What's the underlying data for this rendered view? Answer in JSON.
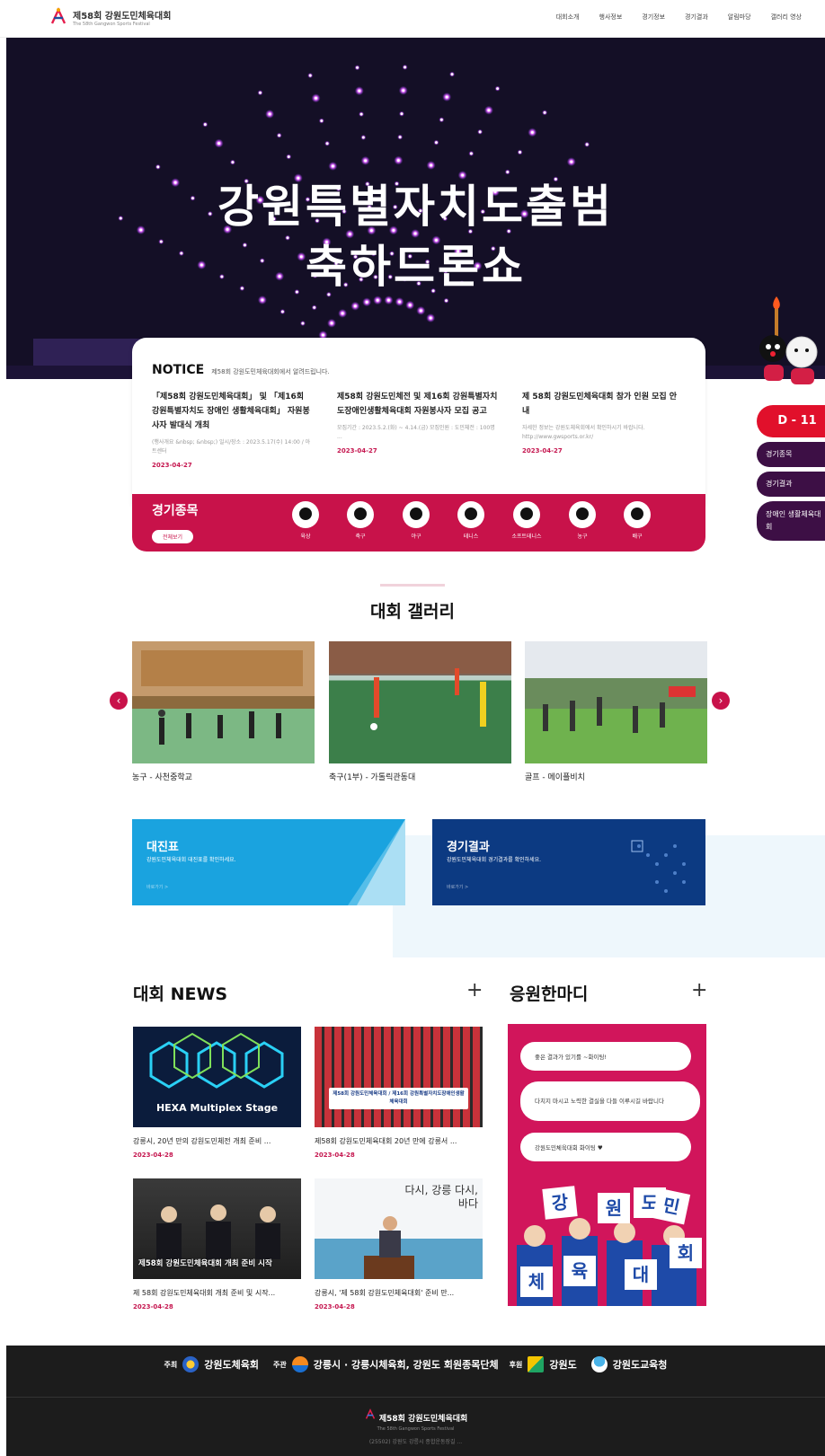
{
  "header": {
    "logo_title": "제58회 강원도민체육대회",
    "logo_sub": "The 58th Gangwon Sports Festival",
    "nav": [
      "대회소개",
      "행사정보",
      "경기정보",
      "경기결과",
      "알림마당",
      "갤러리 영상"
    ]
  },
  "hero": {
    "line1": "강원특별자치도출범",
    "line2": "축하드론쇼"
  },
  "notice": {
    "title": "NOTICE",
    "subtitle": "제58회 강원도민체육대회에서 알려드립니다.",
    "items": [
      {
        "title": "「제58회 강원도민체육대회」 및 「제16회 강원특별자치도 장애인 생활체육대회」 자원봉사자 발대식 개최",
        "summary": "(행사개요 &nbsp; &nbsp;) 일시/장소 : 2023.5.17(수) 14:00 / 아트센터",
        "date": "2023-04-27"
      },
      {
        "title": "제58회 강원도민체전 및 제16회 강원특별자치도장애인생활체육대회 자원봉사자 모집 공고",
        "summary": "모집기간 : 2023.5.2.(화) ~ 4.14.(금) 모집인원 : 도민체전 : 100명 ...",
        "date": "2023-04-27"
      },
      {
        "title": "제 58회 강원도민체육대회 참가 인원 모집 안내",
        "summary": "자세한 정보는 강원도체육회에서 확인하시기 바랍니다. http://www.gwsports.or.kr/",
        "date": "2023-04-27"
      }
    ]
  },
  "sports": {
    "title": "경기종목",
    "all_label": "전체보기",
    "items": [
      "육상",
      "축구",
      "야구",
      "테니스",
      "소프트테니스",
      "농구",
      "배구"
    ]
  },
  "side": {
    "dday": "D - 11",
    "items": [
      "경기종목",
      "경기결과",
      "장애인 생활체육대회"
    ]
  },
  "gallery": {
    "title": "대회 갤러리",
    "items": [
      {
        "label": "농구 - 사천중학교"
      },
      {
        "label": "축구(1부) - 가톨릭관동대"
      },
      {
        "label": "골프 - 메이플비치"
      }
    ]
  },
  "banners": [
    {
      "title": "대진표",
      "sub": "강원도민체육대회 대진표를 확인하세요.",
      "more": "바로가기 >",
      "color": "#1aa3df"
    },
    {
      "title": "경기결과",
      "sub": "강원도민체육대회 경기결과를 확인하세요.",
      "more": "바로가기 >",
      "color": "#0c3a82"
    }
  ],
  "news": {
    "title": "대회 NEWS",
    "items": [
      {
        "title": "강릉시, 20년 만의 강원도민체전 개최 준비 ...",
        "date": "2023-04-28",
        "img_text": "HEXA Multiplex Stage"
      },
      {
        "title": "제58회 강원도민체육대회 20년 만에 강릉서 ...",
        "date": "2023-04-28",
        "img_text": "제58회 강원도민체육대회 / 제16회 강원특별자치도장애인생활체육대회"
      },
      {
        "title": "제 58회 강원도민체육대회 개최 준비 및 시작...",
        "date": "2023-04-28",
        "img_text": "제58회 강원도민체육대회 개최 준비 시작"
      },
      {
        "title": "강릉시, '제 58회 강원도민체육대회' 준비 만...",
        "date": "2023-04-28",
        "img_text": "다시, 강릉 다시, 바다"
      }
    ]
  },
  "cheer": {
    "title": "응원한마디",
    "messages": [
      "좋은 결과가 있기를 ~화이팅!",
      "다치지 마시고 노력한 결실을 다들 이루시길 바랍니다",
      "강원도민체육대회 화이팅 ♥"
    ],
    "letters": [
      "강",
      "원",
      "도",
      "민",
      "체",
      "육",
      "대",
      "회"
    ]
  },
  "footer": {
    "host_label": "주최",
    "host": "강원도체육회",
    "org_label": "주관",
    "org": "강릉시 · 강릉시체육회, 강원도 회원종목단체",
    "sponsor_label": "후원",
    "sponsor1": "강원도",
    "sponsor2": "강원도교육청",
    "logo": "제58회 강원도민체육대회",
    "logo_sub": "The 58th Gangwon Sports Festival",
    "address": "(25502) 강원도 강릉시 종합운동장길 ..."
  },
  "colors": {
    "accent": "#c8124a",
    "hero_bg": "#140f26",
    "blue": "#1aa3df",
    "navy": "#0c3a82"
  }
}
